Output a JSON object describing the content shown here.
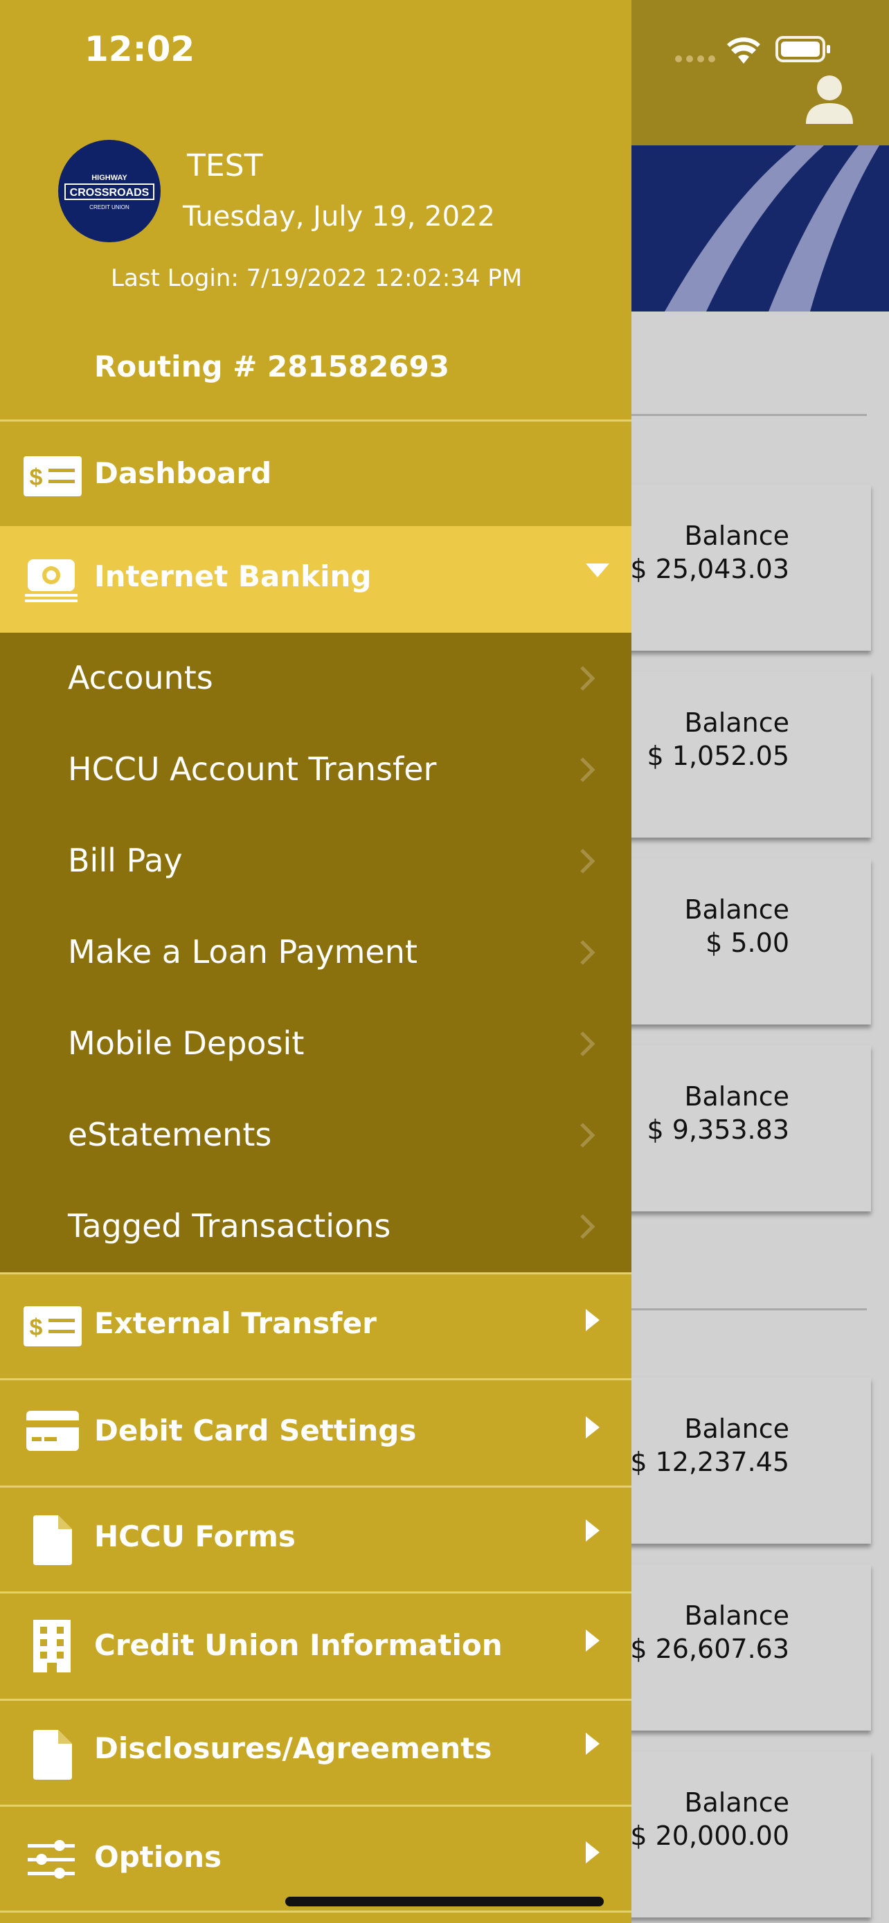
{
  "status_bar": {
    "time": "12:02"
  },
  "user": {
    "name": "TEST",
    "date": "Tuesday, July 19, 2022",
    "last_login": "Last Login: 7/19/2022 12:02:34 PM",
    "routing": "Routing # 281582693"
  },
  "logo": {
    "line1": "HIGHWAY",
    "line2": "CROSSROADS",
    "line3": "CREDIT UNION"
  },
  "menu": {
    "dashboard": "Dashboard",
    "internet_banking": "Internet Banking",
    "sub": [
      "Accounts",
      "HCCU Account Transfer",
      "Bill Pay",
      "Make a Loan Payment",
      "Mobile Deposit",
      "eStatements",
      "Tagged Transactions"
    ],
    "external_transfer": "External Transfer",
    "debit_card_settings": "Debit Card Settings",
    "hccu_forms": "HCCU Forms",
    "credit_union_information": "Credit Union Information",
    "disclosures": "Disclosures/Agreements",
    "options": "Options"
  },
  "balances": [
    {
      "label": "Balance",
      "amount": "$ 25,043.03"
    },
    {
      "label": "Balance",
      "amount": "$ 1,052.05"
    },
    {
      "label": "Balance",
      "amount": "$ 5.00"
    },
    {
      "label": "Balance",
      "amount": "$ 9,353.83"
    },
    {
      "label": "Balance",
      "amount": "$ 12,237.45"
    },
    {
      "label": "Balance",
      "amount": "$ 26,607.63"
    },
    {
      "label": "Balance",
      "amount": "$ 20,000.00"
    }
  ],
  "colors": {
    "drawer": "#c6a826",
    "active": "#ecca48",
    "submenu": "#8b710d",
    "banner": "#16286a"
  }
}
